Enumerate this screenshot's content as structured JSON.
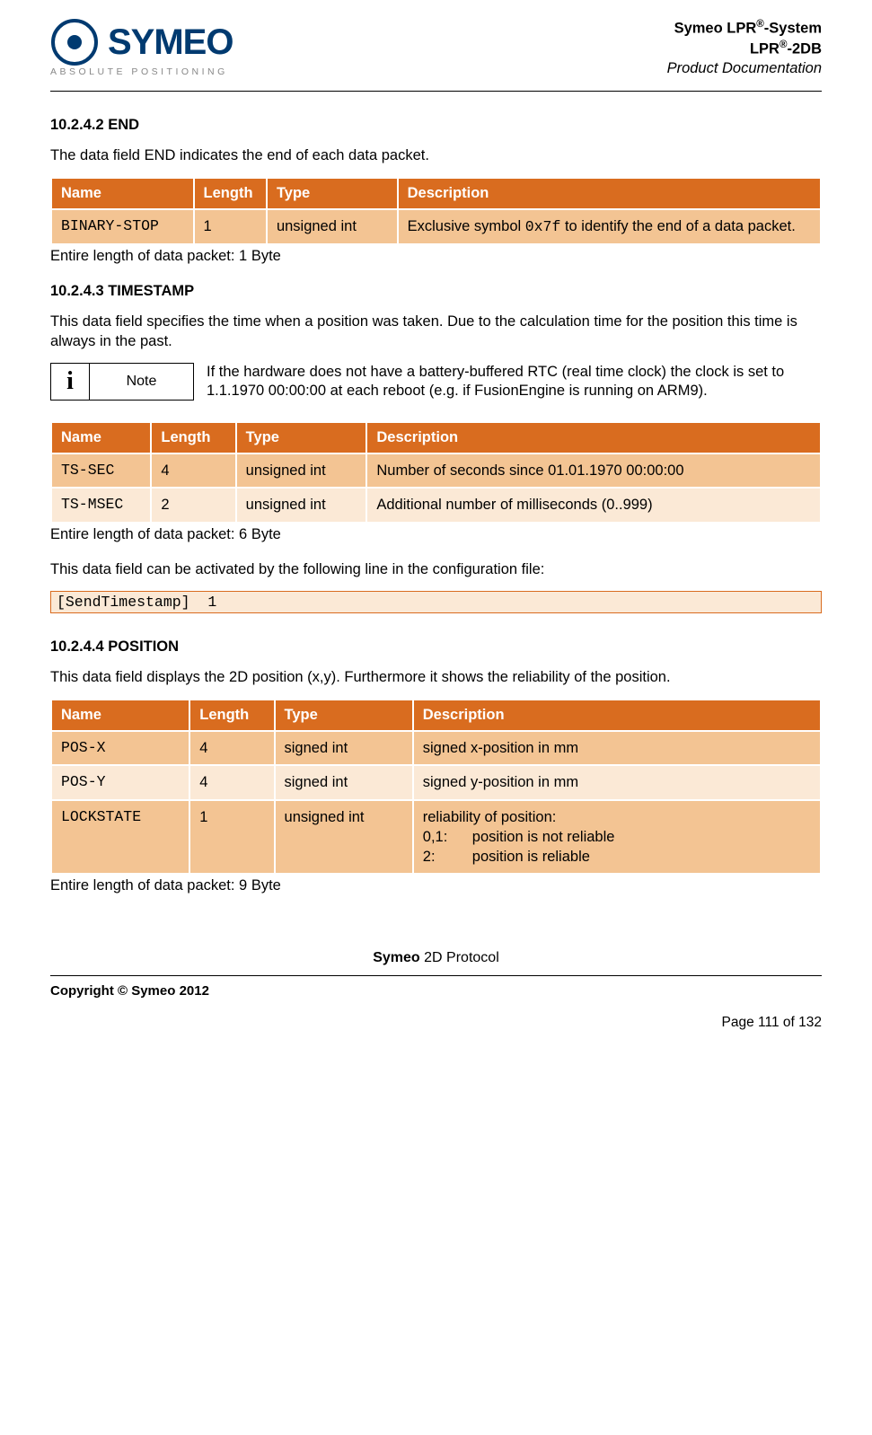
{
  "header": {
    "logo_word": "SYMEO",
    "logo_sub": "ABSOLUTE POSITIONING",
    "title_line1_a": "Symeo LPR",
    "title_line1_b": "-System",
    "title_line2_a": "LPR",
    "title_line2_b": "-2DB",
    "title_line3": "Product Documentation",
    "reg": "®"
  },
  "s1": {
    "heading": "10.2.4.2 END",
    "intro": "The data field END indicates the end of each data packet.",
    "th": {
      "name": "Name",
      "length": "Length",
      "type": "Type",
      "desc": "Description"
    },
    "rows": [
      {
        "name": "BINARY-STOP",
        "length": "1",
        "type": "unsigned int",
        "desc_a": "Exclusive symbol ",
        "desc_code": "0x7f",
        "desc_b": " to identify the end of a data packet."
      }
    ],
    "after": "Entire length of data packet: 1 Byte"
  },
  "s2": {
    "heading": "10.2.4.3 TIMESTAMP",
    "intro": "This data field specifies the time when a position was taken. Due to the calculation time for the position this time is always in the past.",
    "note_label": "Note",
    "note_text": "If the hardware does not have a battery-buffered RTC (real time clock) the clock is set to 1.1.1970 00:00:00 at each reboot (e.g. if FusionEngine is running on ARM9).",
    "th": {
      "name": "Name",
      "length": "Length",
      "type": "Type",
      "desc": "Description"
    },
    "rows": [
      {
        "name": "TS-SEC",
        "length": "4",
        "type": "unsigned int",
        "desc": "Number of seconds since 01.01.1970 00:00:00"
      },
      {
        "name": "TS-MSEC",
        "length": "2",
        "type": "unsigned int",
        "desc": "Additional number of milliseconds (0..999)"
      }
    ],
    "after": "Entire length of data packet: 6 Byte",
    "activate": "This data field can be activated by the following line in the configuration file:",
    "code": "[SendTimestamp]  1"
  },
  "s3": {
    "heading": "10.2.4.4 POSITION",
    "intro": "This data field displays the 2D position (x,y). Furthermore it shows the reliability of the position.",
    "th": {
      "name": "Name",
      "length": "Length",
      "type": "Type",
      "desc": "Description"
    },
    "rows": [
      {
        "name": "POS-X",
        "length": "4",
        "type": "signed int",
        "desc": "signed x-position in mm"
      },
      {
        "name": "POS-Y",
        "length": "4",
        "type": "signed int",
        "desc": "signed y-position in mm"
      }
    ],
    "lockrow": {
      "name": "LOCKSTATE",
      "length": "1",
      "type": "unsigned int",
      "d0": "reliability of position:",
      "k1": "0,1:",
      "v1": "position is not reliable",
      "k2": "2:",
      "v2": "position is reliable"
    },
    "after": "Entire length of data packet: 9 Byte"
  },
  "footer": {
    "protocol_a": "Symeo",
    "protocol_b": " 2D Protocol",
    "copyright": "Copyright © Symeo 2012",
    "page": "Page 111 of 132"
  },
  "col_widths": {
    "name": "18%",
    "length": "11%",
    "type": "18%",
    "desc": "53%"
  },
  "col_widths_s1": {
    "name": "18.5%",
    "length": "9.5%",
    "type": "17%",
    "desc": "55%"
  },
  "col_widths_s2": {
    "name": "13%",
    "length": "11%",
    "type": "17%",
    "desc": "59%"
  }
}
